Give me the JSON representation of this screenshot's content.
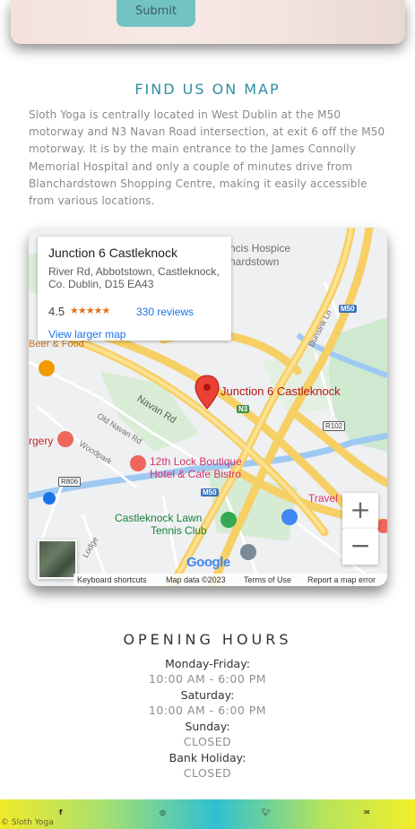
{
  "form": {
    "submit_label": "Submit"
  },
  "find_us": {
    "title": "FIND US ON MAP",
    "description": "Sloth Yoga is centrally located in West Dublin at the M50 motorway and N3 Navan Road intersection, at exit 6 off the M50 motorway. It is by the main entrance to the James Connolly Memorial Hospital and only a couple of minutes drive from Blanchardstown Shopping Centre, making it easily accessible from various locations."
  },
  "map": {
    "place_name": "Junction 6 Castleknock",
    "address": "River Rd, Abbotstown, Castleknock, Co. Dublin, D15 EA43",
    "rating": "4.5",
    "stars": "★★★★★",
    "reviews": "330 reviews",
    "view_larger": "View larger map",
    "pin_label": "Junction 6 Castleknock",
    "labels": {
      "hospice": "ncis Hospice",
      "blanchardstown": "nardstown",
      "beer_food": "Beer & Food",
      "navan_rd": "Navan Rd",
      "old_navan_rd": "Old Navan Rd",
      "woodpark": "Woodpark",
      "surgery": "rgery",
      "lock_hotel_1": "12th Lock Boutique",
      "lock_hotel_2": "Hotel & Cafe Bistro",
      "lawn_tennis_1": "Castleknock Lawn",
      "lawn_tennis_2": "Tennis Club",
      "travel": "Travel",
      "dunsink": "Dunsink Ln",
      "lodge": "Lodge",
      "shield_m50_a": "M50",
      "shield_m50_b": "M50",
      "shield_n3": "N3",
      "shield_r102": "R102",
      "shield_r806": "R806",
      "google": "Google"
    },
    "zoom_in": "+",
    "zoom_out": "−",
    "footer": {
      "shortcuts": "Keyboard shortcuts",
      "data": "Map data ©2023",
      "terms": "Terms of Use",
      "report": "Report a map error"
    }
  },
  "hours": {
    "title": "OPENING HOURS",
    "entries": [
      {
        "day": "Monday-Friday:",
        "time": "10:00 AM - 6:00 PM"
      },
      {
        "day": "Saturday:",
        "time": "10:00 AM - 6:00 PM"
      },
      {
        "day": "Sunday:",
        "time": "CLOSED"
      },
      {
        "day": "Bank Holiday:",
        "time": "CLOSED"
      }
    ]
  },
  "footer": {
    "copyright": "© Sloth Yoga",
    "icons": [
      "facebook-icon",
      "instagram-icon",
      "twitter-icon",
      "email-icon"
    ]
  },
  "colors": {
    "accent": "#2e8ea0",
    "button": "#74c3c3",
    "link": "#1a73e8",
    "pin": "#ea4335"
  }
}
